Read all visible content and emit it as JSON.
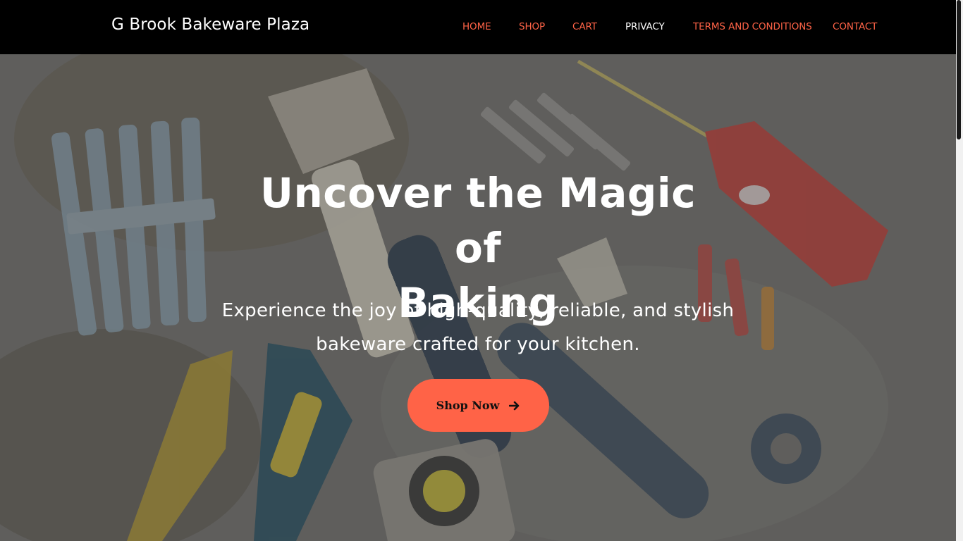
{
  "site": {
    "brand": "G Brook Bakeware Plaza"
  },
  "nav": {
    "items": [
      {
        "label": "HOME",
        "active": false
      },
      {
        "label": "SHOP",
        "active": false
      },
      {
        "label": "CART",
        "active": false
      },
      {
        "label": "PRIVACY",
        "active": true
      },
      {
        "label": "TERMS AND CONDITIONS",
        "active": false
      },
      {
        "label": "CONTACT",
        "active": false
      }
    ]
  },
  "hero": {
    "title_line1": "Uncover the Magic of",
    "title_line2": "Baking",
    "subtitle_line1": "Experience the joy of high-quality, reliable, and stylish",
    "subtitle_line2": "bakeware crafted for your kitchen.",
    "cta_label": "Shop Now",
    "cta_icon": "arrow-right-icon",
    "background_image": "tools-on-concrete-photo"
  },
  "colors": {
    "accent": "#ff6347",
    "navbar_bg": "#000000",
    "active_link": "#ffffff"
  }
}
